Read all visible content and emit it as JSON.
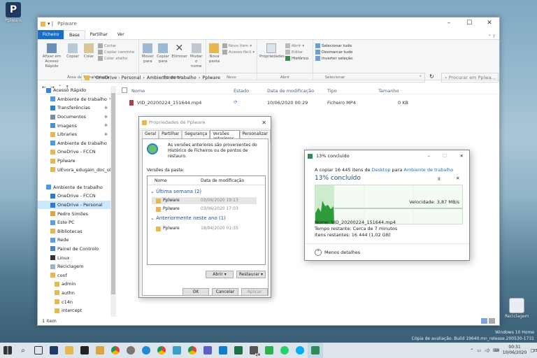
{
  "desktop": {
    "icon1_label": "Pplware",
    "recycle_label": "Reciclagem",
    "watermark1": "Windows 10 Home",
    "watermark2": "Cópia de avaliação. Build 19640.mn_release.200530-1731"
  },
  "explorer": {
    "title": "Pplware",
    "tabs": [
      "Ficheiro",
      "Base",
      "Partilhar",
      "Ver"
    ],
    "ribbon": {
      "clipboard": {
        "pin": "Afixar em Acesso Rápido",
        "copy": "Copiar",
        "paste": "Colar",
        "cut": "Cortar",
        "copy_path": "Copiar caminho",
        "paste_shortcut": "Colar atalho",
        "label": "Área de Transferência"
      },
      "organize": {
        "move": "Mover para",
        "copyto": "Copiar para",
        "delete": "Eliminar",
        "rename": "Mudar o nome",
        "label": "Organizar"
      },
      "new": {
        "folder": "Nova pasta",
        "item": "Novo item",
        "easy": "Acesso fácil",
        "label": "Novo"
      },
      "open": {
        "props": "Propriedades",
        "open": "Abrir",
        "edit": "Editar",
        "history": "Histórico",
        "label": "Abrir"
      },
      "select": {
        "all": "Selecionar tudo",
        "none": "Desmarcar tudo",
        "invert": "Inverter seleção",
        "label": "Selecionar"
      }
    },
    "breadcrumb": [
      "OneDrive - Personal",
      "Ambiente de trabalho",
      "Pplware"
    ],
    "search_placeholder": "Procurar em Pplwa...",
    "nav": [
      {
        "label": "Acesso Rápido",
        "pin": false,
        "color": "#3a86d6",
        "indent": 0,
        "sel": false
      },
      {
        "label": "Ambiente de trabalho",
        "pin": true,
        "color": "#4a9be0",
        "indent": 1,
        "sel": false
      },
      {
        "label": "Transferências",
        "pin": true,
        "color": "#2f7fd1",
        "indent": 1,
        "sel": false
      },
      {
        "label": "Documentos",
        "pin": true,
        "color": "#7a8ea3",
        "indent": 1,
        "sel": false
      },
      {
        "label": "Imagens",
        "pin": true,
        "color": "#4e8fcf",
        "indent": 1,
        "sel": false
      },
      {
        "label": "Libraries",
        "pin": true,
        "color": "#e6b84f",
        "indent": 1,
        "sel": false
      },
      {
        "label": "Ambiente de trabalho",
        "pin": false,
        "color": "#4a9be0",
        "indent": 1,
        "sel": false
      },
      {
        "label": "OneDrive - FCCN",
        "pin": false,
        "color": "#e6b84f",
        "indent": 1,
        "sel": false
      },
      {
        "label": "Pplware",
        "pin": false,
        "color": "#e6b84f",
        "indent": 1,
        "sel": false
      },
      {
        "label": "UEvora_edugain_doc_ok_a",
        "pin": false,
        "color": "#e6b84f",
        "indent": 1,
        "sel": false
      },
      {
        "label": "",
        "pin": false,
        "color": "",
        "indent": 0,
        "sel": false
      },
      {
        "label": "Ambiente de trabalho",
        "pin": false,
        "color": "#4a9be0",
        "indent": 0,
        "sel": false
      },
      {
        "label": "OneDrive - FCCN",
        "pin": false,
        "color": "#2a7bd6",
        "indent": 1,
        "sel": false
      },
      {
        "label": "OneDrive - Personal",
        "pin": false,
        "color": "#2a7bd6",
        "indent": 1,
        "sel": true
      },
      {
        "label": "Pedro Simões",
        "pin": false,
        "color": "#d9a441",
        "indent": 1,
        "sel": false
      },
      {
        "label": "Este PC",
        "pin": false,
        "color": "#5aa0dc",
        "indent": 1,
        "sel": false
      },
      {
        "label": "Bibliotecas",
        "pin": false,
        "color": "#e6b84f",
        "indent": 1,
        "sel": false
      },
      {
        "label": "Rede",
        "pin": false,
        "color": "#5aa0dc",
        "indent": 1,
        "sel": false
      },
      {
        "label": "Painel de Controlo",
        "pin": false,
        "color": "#4f83c4",
        "indent": 1,
        "sel": false
      },
      {
        "label": "Linux",
        "pin": false,
        "color": "#333333",
        "indent": 1,
        "sel": false
      },
      {
        "label": "Reciclagem",
        "pin": false,
        "color": "#9fb3c6",
        "indent": 1,
        "sel": false
      },
      {
        "label": "conf",
        "pin": false,
        "color": "#e6b84f",
        "indent": 1,
        "sel": false
      },
      {
        "label": "admin",
        "pin": false,
        "color": "#e6b84f",
        "indent": 2,
        "sel": false
      },
      {
        "label": "authn",
        "pin": false,
        "color": "#e6b84f",
        "indent": 2,
        "sel": false
      },
      {
        "label": "c14n",
        "pin": false,
        "color": "#e6b84f",
        "indent": 2,
        "sel": false
      },
      {
        "label": "intercept",
        "pin": false,
        "color": "#e6b84f",
        "indent": 2,
        "sel": false
      }
    ],
    "columns": {
      "name": "Nome",
      "state": "Estado",
      "date": "Data de modificação",
      "type": "Tipo",
      "size": "Tamanho"
    },
    "file": {
      "name": "VID_20200224_151644.mp4",
      "date": "10/06/2020 00:29",
      "type": "Ficheiro MP4",
      "size": "0 KB"
    },
    "status": "1 item"
  },
  "props_dialog": {
    "title": "Propriedades de Pplware",
    "tabs": [
      "Geral",
      "Partilhar",
      "Segurança",
      "Versões anteriores",
      "Personalizar"
    ],
    "info": "As versões anteriores são provenientes do Histórico de Ficheiros ou de pontos de restauro.",
    "versions_label": "Versões da pasta:",
    "col_name": "Nome",
    "col_date": "Data de modificação",
    "group1": "Última semana (2)",
    "group2": "Anteriormente neste ano (1)",
    "rows1": [
      {
        "name": "Pplware",
        "date": "03/06/2020 19:13"
      },
      {
        "name": "Pplware",
        "date": "03/06/2020 17:03"
      }
    ],
    "rows2": [
      {
        "name": "Pplware",
        "date": "18/04/2020 01:35"
      }
    ],
    "open": "Abrir",
    "restore": "Restaurar",
    "ok": "OK",
    "cancel": "Cancelar",
    "apply": "Aplicar"
  },
  "copy_dialog": {
    "title": "13% concluído",
    "line_prefix": "A copiar 16 445 itens de ",
    "src": "Desktop",
    "mid": " para ",
    "dst": "Ambiente de trabalho",
    "percent": "13% concluído",
    "speed": "Velocidade: 3,87 MB/s",
    "progress": 0.13,
    "name": "Nome: VID_20200224_151644.mp4",
    "time": "Tempo restante: Cerca de 7 minutos",
    "items": "Itens restantes: 16 444 (1,02 GB)",
    "less": "Menos detalhes"
  },
  "taskbar": {
    "time": "00:31",
    "date": "10/06/2020",
    "badge1": "24",
    "badge2": "25"
  }
}
